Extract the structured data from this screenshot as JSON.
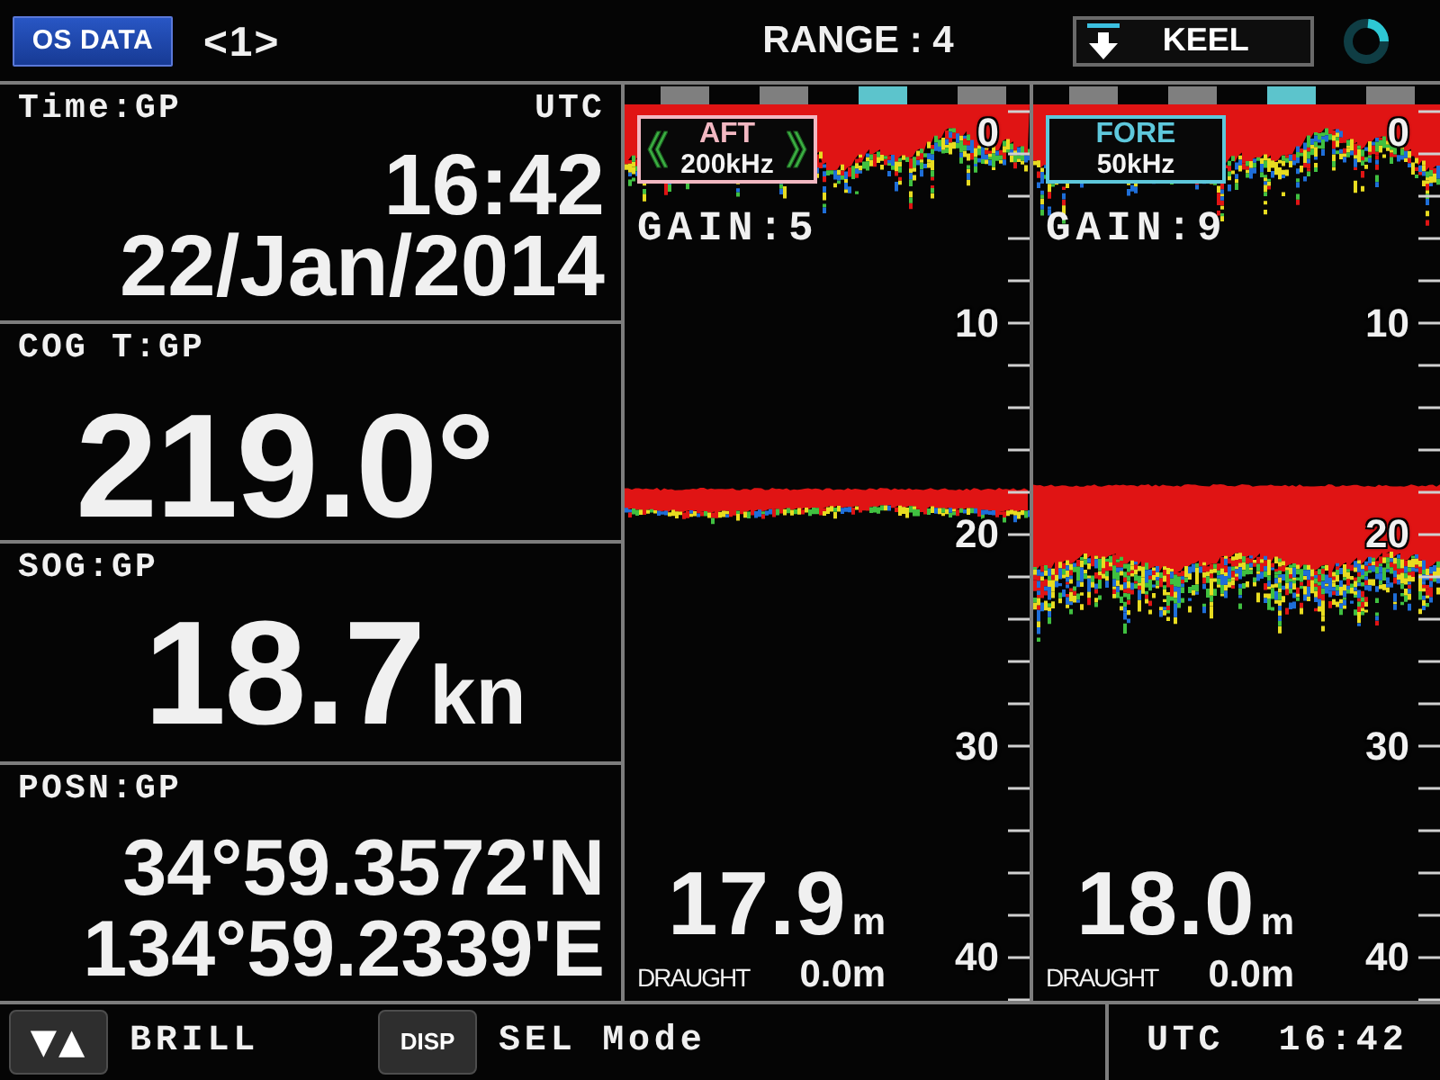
{
  "top_bar": {
    "mode_button": "OS DATA",
    "page_indicator": "<1>",
    "range": "RANGE : 4",
    "keel_button": "KEEL"
  },
  "data_cells": [
    {
      "kind": "time",
      "label": "Time:GP",
      "unit_label": "UTC",
      "lines": [
        "16:42",
        "22/Jan/2014"
      ]
    },
    {
      "kind": "value",
      "label": "COG T:GP",
      "value": "219.0°"
    },
    {
      "kind": "value",
      "label": "SOG:GP",
      "value": "18.7",
      "unit": "kn"
    },
    {
      "kind": "position",
      "label": "POSN:GP",
      "lines": [
        "34°59.3572'N",
        "134°59.2339'E"
      ]
    }
  ],
  "echo_panels": [
    {
      "transducer": "AFT",
      "frequency": "200kHz",
      "color": "#f2b8c2",
      "selected": true,
      "gain": "GAIN:5",
      "segments": [
        {
          "color": "#7f7f7f"
        },
        {
          "color": "#7f7f7f"
        },
        {
          "color": "#5cc4cc"
        },
        {
          "color": "#7f7f7f"
        }
      ],
      "scale_labels": [
        "0",
        "10",
        "20",
        "30",
        "40"
      ],
      "depth": "17.9",
      "depth_unit": "m",
      "draught_label": "DRAUGHT",
      "draught": "0.0m"
    },
    {
      "transducer": "FORE",
      "frequency": "50kHz",
      "color": "#5ec8dc",
      "selected": false,
      "gain": "GAIN:9",
      "segments": [
        {
          "color": "#7f7f7f"
        },
        {
          "color": "#7f7f7f"
        },
        {
          "color": "#5cc4cc"
        },
        {
          "color": "#7f7f7f"
        }
      ],
      "scale_labels": [
        "0",
        "10",
        "20",
        "30",
        "40"
      ],
      "depth": "18.0",
      "depth_unit": "m",
      "draught_label": "DRAUGHT",
      "draught": "0.0m"
    }
  ],
  "bottom_bar": {
    "brightness_key": "▼▲",
    "brightness_label": "BRILL",
    "disp_key": "DISP",
    "disp_label": "SEL Mode",
    "clock_label": "UTC",
    "clock": "16:42"
  }
}
